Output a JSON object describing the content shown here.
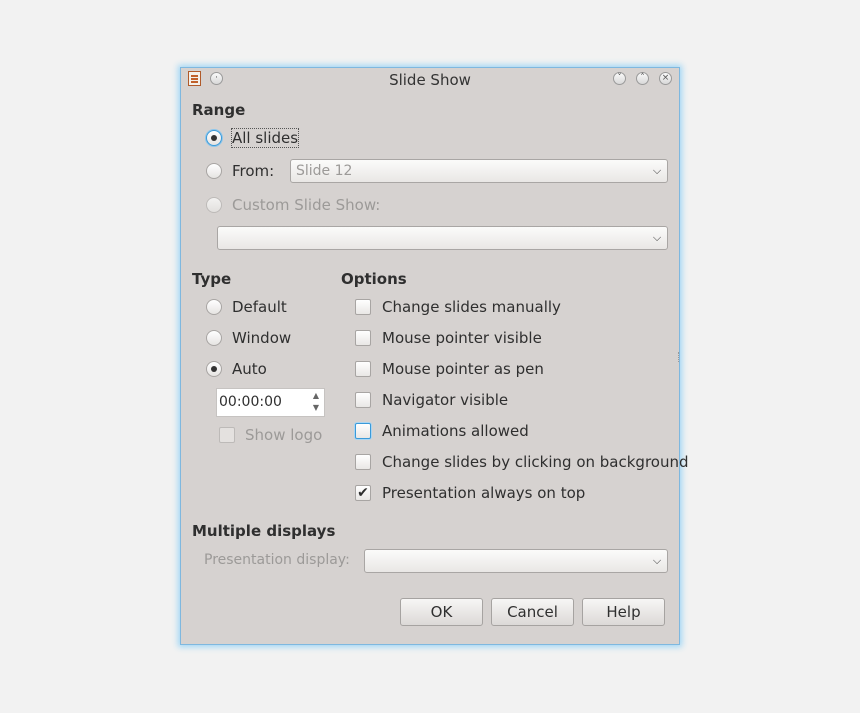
{
  "dialog": {
    "title": "Slide Show"
  },
  "range": {
    "heading": "Range",
    "all_slides": "All slides",
    "from_label": "From:",
    "from_value": "Slide 12",
    "custom_label": "Custom Slide Show:",
    "custom_value": ""
  },
  "type": {
    "heading": "Type",
    "default_label": "Default",
    "window_label": "Window",
    "auto_label": "Auto",
    "auto_time": "00:00:00",
    "show_logo": "Show logo"
  },
  "options": {
    "heading": "Options",
    "items": [
      {
        "label": "Change slides manually",
        "checked": false
      },
      {
        "label": "Mouse pointer visible",
        "checked": false
      },
      {
        "label": "Mouse pointer as pen",
        "checked": false
      },
      {
        "label": "Navigator visible",
        "checked": false
      },
      {
        "label": "Animations allowed",
        "checked": false
      },
      {
        "label": "Change slides by clicking on background",
        "checked": false
      },
      {
        "label": "Presentation always on top",
        "checked": true
      }
    ]
  },
  "displays": {
    "heading": "Multiple displays",
    "presentation_label": "Presentation display:",
    "presentation_value": ""
  },
  "buttons": {
    "ok": "OK",
    "cancel": "Cancel",
    "help": "Help"
  },
  "icons": {
    "app": "impress-document-icon",
    "menu": "window-menu-icon",
    "minimize": "chevron-down-icon",
    "maximize": "chevron-up-icon",
    "close": "close-icon"
  },
  "colors": {
    "dialog_bg": "#d6d2d0",
    "focus": "#3a9ad9",
    "glow": "#9fd6f5"
  }
}
